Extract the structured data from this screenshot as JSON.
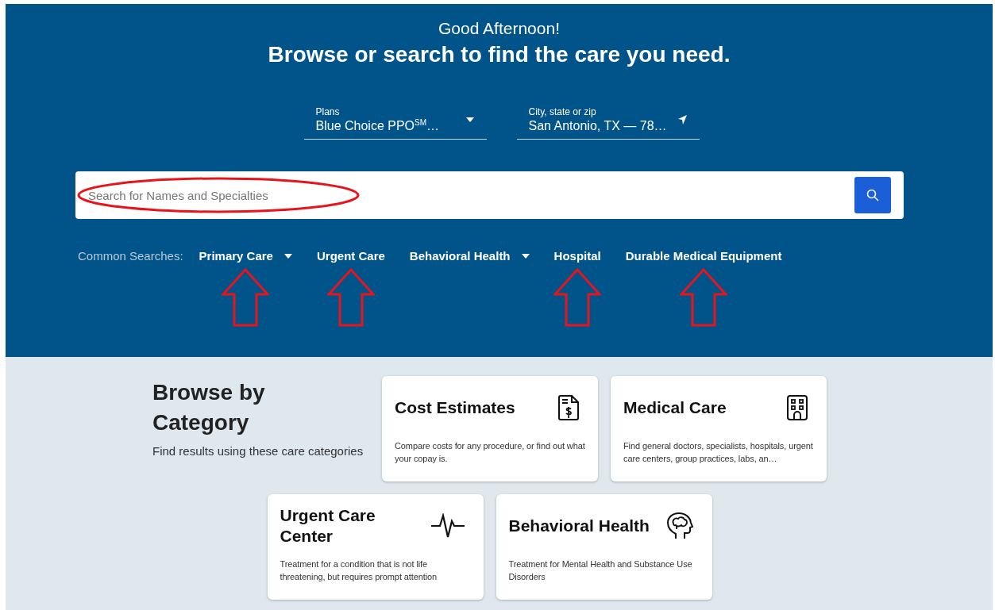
{
  "greeting": "Good Afternoon!",
  "headline": "Browse or search to find the care you need.",
  "fields": [
    {
      "kind": "select",
      "label": "Plans",
      "value": "Blue Choice PPO$^{SM}$…"
    },
    {
      "kind": "location",
      "label": "City, state or zip",
      "value": "San Antonio, TX — 78…"
    }
  ],
  "search": {
    "placeholder": "Search for Names and Specialties",
    "circled": true
  },
  "common_searches": {
    "label": "Common Searches:",
    "items": [
      {
        "label": "Primary Care",
        "has_menu": true,
        "arrowed": true
      },
      {
        "label": "Urgent Care",
        "has_menu": false,
        "arrowed": true
      },
      {
        "label": "Behavioral Health",
        "has_menu": true,
        "arrowed": false
      },
      {
        "label": "Hospital",
        "has_menu": false,
        "arrowed": true
      },
      {
        "label": "Durable Medical Equipment",
        "has_menu": false,
        "arrowed": true
      }
    ]
  },
  "browse": {
    "title": "Browse by Category",
    "subtitle": "Find results using these care categories"
  },
  "categories": [
    {
      "kind": "cost",
      "title": "Cost Estimates",
      "description": "Compare costs for any procedure, or find out what your copay is."
    },
    {
      "kind": "medical",
      "title": "Medical Care",
      "description": "Find general doctors, specialists, hospitals, urgent care centers, group practices, labs, an…"
    },
    {
      "kind": "urgent",
      "title": "Urgent Care Center",
      "description": "Treatment for a condition that is not life threatening, but requires prompt attention"
    },
    {
      "kind": "behavioral",
      "title": "Behavioral Health",
      "description": "Treatment for Mental Health and Substance Use Disorders"
    }
  ]
}
